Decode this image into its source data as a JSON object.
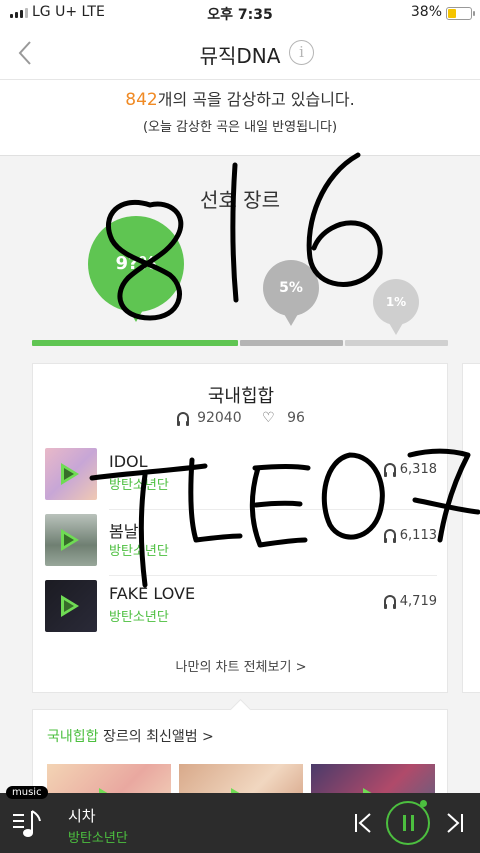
{
  "status_bar": {
    "carrier": "LG U+  LTE",
    "time": "오후 7:35",
    "battery": "38%",
    "battery_level": 0.38
  },
  "nav": {
    "title": "뮤직DNA",
    "info_glyph": "i"
  },
  "summary": {
    "count": "842",
    "line1_suffix": "개의 곡을 감상하고 있습니다.",
    "line2": "(오늘 감상한 곡은 내일 반영됩니다)"
  },
  "preference": {
    "title": "선호 장르",
    "bubbles": [
      {
        "label": "9?%",
        "color": "#5fc552"
      },
      {
        "label": "5%",
        "color": "#b4b4b4"
      },
      {
        "label": "1%",
        "color": "#cfcfcf"
      }
    ],
    "bar": [
      {
        "share": 0.5,
        "color": "#5fc552"
      },
      {
        "share": 0.25,
        "color": "#b4b4b4"
      },
      {
        "share": 0.25,
        "color": "#d0d0d0"
      }
    ]
  },
  "genre_card": {
    "title": "국내힙합",
    "plays": "92040",
    "likes": "96",
    "songs": [
      {
        "title": "IDOL",
        "artist": "방탄소년단",
        "plays": "6,318"
      },
      {
        "title": "봄날",
        "artist": "방탄소년단",
        "plays": "6,113"
      },
      {
        "title": "FAKE LOVE",
        "artist": "방탄소년단",
        "plays": "4,719"
      }
    ],
    "more_label": "나만의 차트 전체보기 >"
  },
  "new_albums": {
    "genre": "국내힙합",
    "title_suffix": " 장르의 최신앨범 >"
  },
  "player": {
    "tag": "music",
    "title": "시차",
    "artist": "방탄소년단",
    "accent": "#4cbf3f"
  },
  "handwriting": [
    "816",
    "TLE 07"
  ]
}
